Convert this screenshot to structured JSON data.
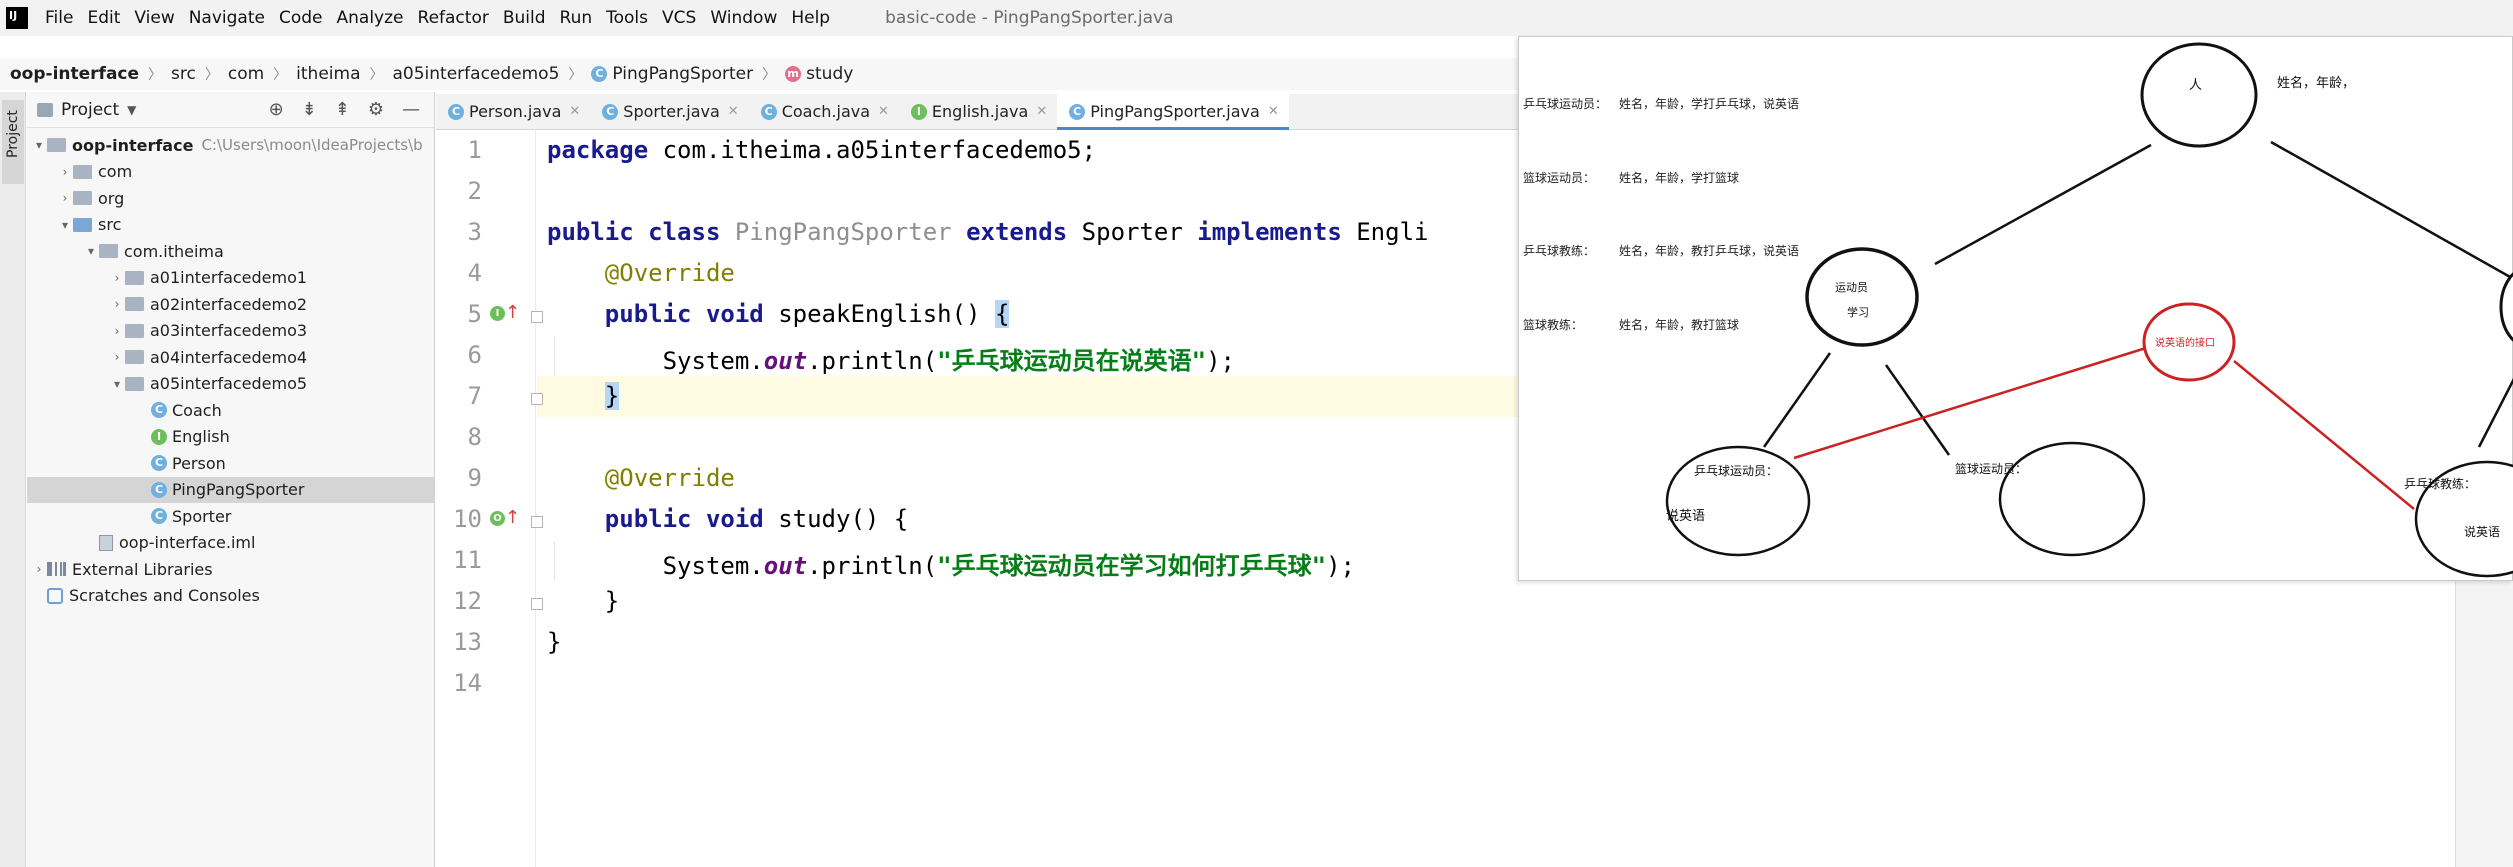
{
  "menubar": {
    "items": [
      "File",
      "Edit",
      "View",
      "Navigate",
      "Code",
      "Analyze",
      "Refactor",
      "Build",
      "Run",
      "Tools",
      "VCS",
      "Window",
      "Help"
    ],
    "window_title": "basic-code - PingPangSporter.java"
  },
  "breadcrumb": {
    "items": [
      "oop-interface",
      "src",
      "com",
      "itheima",
      "a05interfacedemo5",
      "PingPangSporter",
      "study"
    ]
  },
  "toolstrip": {
    "project_tab": "Project"
  },
  "project_panel": {
    "title": "Project",
    "tree": [
      {
        "label": "oop-interface",
        "hint": "C:\\Users\\moon\\IdeaProjects\\b"
      },
      {
        "label": "com"
      },
      {
        "label": "org"
      },
      {
        "label": "src"
      },
      {
        "label": "com.itheima"
      },
      {
        "label": "a01interfacedemo1"
      },
      {
        "label": "a02interfacedemo2"
      },
      {
        "label": "a03interfacedemo3"
      },
      {
        "label": "a04interfacedemo4"
      },
      {
        "label": "a05interfacedemo5"
      },
      {
        "label": "Coach"
      },
      {
        "label": "English"
      },
      {
        "label": "Person"
      },
      {
        "label": "PingPangSporter"
      },
      {
        "label": "Sporter"
      },
      {
        "label": "oop-interface.iml"
      },
      {
        "label": "External Libraries"
      },
      {
        "label": "Scratches and Consoles"
      }
    ]
  },
  "tabs": [
    {
      "label": "Person.java"
    },
    {
      "label": "Sporter.java"
    },
    {
      "label": "Coach.java"
    },
    {
      "label": "English.java"
    },
    {
      "label": "PingPangSporter.java"
    }
  ],
  "editor": {
    "line_numbers": [
      "1",
      "2",
      "3",
      "4",
      "5",
      "6",
      "7",
      "8",
      "9",
      "10",
      "11",
      "12",
      "13",
      "14"
    ],
    "tokens": {
      "package_kw": "package",
      "package_name": " com.itheima.a05interfacedemo5;",
      "public": "public",
      "class": "class",
      "class_name": "PingPangSporter",
      "extends": "extends",
      "super": "Sporter",
      "implements": "implements",
      "iface": "Engli",
      "override": "@Override",
      "void": "void",
      "speak_sig": "speakEnglish() ",
      "open_brace": "{",
      "close_brace": "}",
      "system": "System.",
      "out": "out",
      "println": ".println(",
      "str1": "\"乒乓球运动员在说英语\"",
      "end": ");",
      "study_sig": "study() {",
      "str2": "\"乒乓球运动员在学习如何打乒乓球\"",
      "class_close": "}"
    }
  },
  "diagram": {
    "notes": [
      {
        "label": "乒乓球运动员：",
        "text": "姓名，年龄，学打乒乓球，说英语"
      },
      {
        "label": "篮球运动员：",
        "text": "姓名，年龄，学打篮球"
      },
      {
        "label": "乒乓球教练：",
        "text": "姓名，年龄，教打乒乓球，说英语"
      },
      {
        "label": "篮球教练：",
        "text": "姓名，年龄，教打篮球"
      }
    ],
    "person_node": "人",
    "person_attrs": "姓名，年龄，",
    "athlete_node_line1": "运动员",
    "athlete_node_line2": "学习",
    "interface_node": "说英语的接口",
    "pp_athlete_line1": "乒乓球运动员：",
    "pp_athlete_line2": "说英语",
    "bb_athlete": "篮球运动员：",
    "pp_coach_line1": "乒乓球教练：",
    "pp_coach_line2": "说英语",
    "red_color": "#cc2222"
  }
}
